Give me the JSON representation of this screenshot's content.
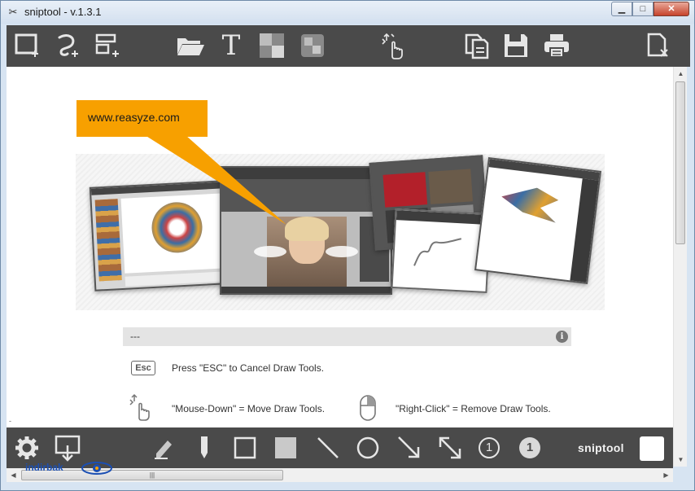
{
  "window": {
    "title": "sniptool - v.1.3.1",
    "controls": {
      "minimize": "▁",
      "maximize": "□",
      "close": "✕"
    }
  },
  "toolbar": {
    "icons": [
      "rect-select-add-icon",
      "freeform-select-add-icon",
      "window-select-add-icon",
      "open-folder-icon",
      "text-icon",
      "pixelate-icon",
      "blur-icon",
      "move-tool-icon",
      "copy-icon",
      "save-icon",
      "print-icon",
      "close-doc-icon"
    ],
    "text_tool_glyph": "T"
  },
  "canvas": {
    "callout_text": "www.reasyze.com",
    "info_panel": {
      "header": "---",
      "info_glyph": "i",
      "esc_key": "Esc",
      "esc_text": "Press \"ESC\" to Cancel Draw Tools.",
      "mouse_down_text": "\"Mouse-Down\" = Move Draw Tools.",
      "right_click_text": "\"Right-Click\" = Remove Draw Tools."
    }
  },
  "bottombar": {
    "icons": [
      "settings-gear-icon",
      "export-screen-icon",
      "marker-icon",
      "pen-icon",
      "rectangle-outline-icon",
      "rectangle-filled-icon",
      "line-icon",
      "circle-icon",
      "arrow-icon",
      "double-arrow-icon",
      "number-outline-icon",
      "number-filled-icon"
    ],
    "number_glyph": "1",
    "brand": "sniptool",
    "accent_color": "#ffffff"
  },
  "watermark": "indirbak",
  "colors": {
    "toolbar_bg": "#4a4a4a",
    "callout": "#f7a000",
    "icon": "#e6e6e6"
  }
}
